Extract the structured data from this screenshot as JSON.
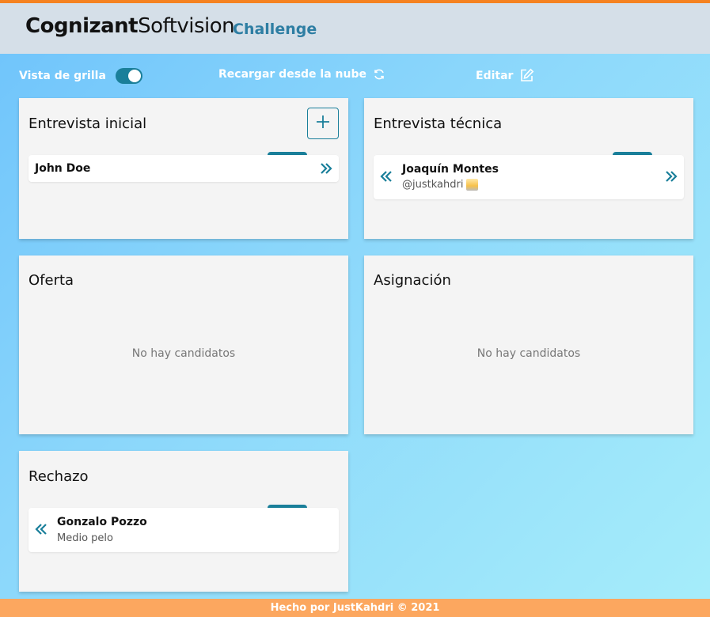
{
  "header": {
    "brand_part1": "Cognizant",
    "brand_part2": "Softvision",
    "subtitle": "Challenge"
  },
  "toolbar": {
    "grid_toggle_label": "Vista de grilla",
    "grid_toggle_on": true,
    "reload_label": "Recargar desde la nube",
    "edit_label": "Editar"
  },
  "panels": [
    {
      "title": "Entrevista inicial",
      "candidates": [
        {
          "name": "John Doe",
          "comment": ""
        }
      ]
    },
    {
      "title": "Entrevista técnica",
      "candidates": [
        {
          "name": "Joaquín Montes",
          "comment": "@justkahdri"
        }
      ]
    },
    {
      "title": "Oferta",
      "empty_label": "No hay candidatos",
      "candidates": []
    },
    {
      "title": "Asignación",
      "empty_label": "No hay candidatos",
      "candidates": []
    },
    {
      "title": "Rechazo",
      "candidates": [
        {
          "name": "Gonzalo Pozzo",
          "comment": "Medio pelo"
        }
      ]
    }
  ],
  "footer": {
    "text": "Hecho por JustKahdri © 2021"
  },
  "colors": {
    "accent": "#1a7f9a",
    "top_bar": "#f58220",
    "footer_bg": "#fca75f",
    "header_bg": "#d5dfe8"
  }
}
